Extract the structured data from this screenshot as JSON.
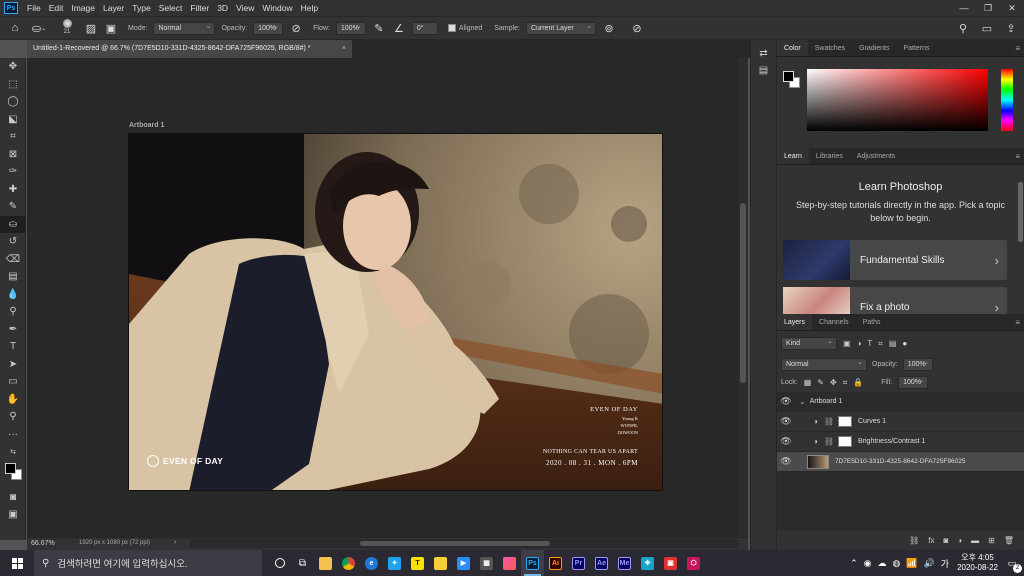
{
  "menu": {
    "app_badge": "Ps",
    "items": [
      "File",
      "Edit",
      "Image",
      "Layer",
      "Type",
      "Select",
      "Filter",
      "3D",
      "View",
      "Window",
      "Help"
    ]
  },
  "options": {
    "brush_size": "21",
    "mode_label": "Mode:",
    "mode_value": "Normal",
    "opacity_label": "Opacity:",
    "opacity_value": "100%",
    "flow_label": "Flow:",
    "flow_value": "100%",
    "angle_value": "0°",
    "aligned_label": "Aligned",
    "sample_label": "Sample:",
    "sample_value": "Current Layer"
  },
  "document": {
    "tab_title": "Untitled-1-Recovered @ 66.7% (7D7E5D10-331D-4325-8642-DFA725F96025, RGB/8#) *",
    "artboard_label": "Artboard 1",
    "zoom": "66.67%",
    "doc_info": "1920 px x 1080 px (72 ppi)"
  },
  "poster": {
    "title": "EVEN OF DAY",
    "members": [
      "Young K",
      "WONPIL",
      "DOWOON"
    ],
    "tagline": "NOTHING CAN TEAR US APART",
    "date": "2020 . 08 . 31 . MON . 6PM",
    "logo_text": "EVEN OF DAY"
  },
  "color_panel": {
    "tabs": [
      "Color",
      "Swatches",
      "Gradients",
      "Patterns"
    ],
    "active_tab": "Color",
    "hue_color": "#ff0000"
  },
  "learn_panel": {
    "tabs": [
      "Learn",
      "Libraries",
      "Adjustments"
    ],
    "heading": "Learn Photoshop",
    "desc": "Step-by-step tutorials directly in the app. Pick a topic below to begin.",
    "cards": [
      {
        "label": "Fundamental Skills"
      },
      {
        "label": "Fix a photo"
      }
    ]
  },
  "layers_panel": {
    "tabs": [
      "Layers",
      "Channels",
      "Paths"
    ],
    "filter_value": "Kind",
    "blend_mode": "Normal",
    "opacity_label": "Opacity:",
    "opacity_value": "100%",
    "lock_label": "Lock:",
    "fill_label": "Fill:",
    "fill_value": "100%",
    "layers": [
      {
        "name": "Artboard 1"
      },
      {
        "name": "Curves 1"
      },
      {
        "name": "Brightness/Contrast 1"
      },
      {
        "name": "7D7E5D10-331D-4325-8642-DFA725F96025"
      }
    ]
  },
  "taskbar": {
    "search_placeholder": "검색하려면 여기에 입력하십시오.",
    "time": "오후 4:05",
    "date": "2020-08-22",
    "notif_count": "2",
    "apps": [
      "Ps",
      "Ai",
      "Pr",
      "Ae",
      "Me"
    ]
  }
}
